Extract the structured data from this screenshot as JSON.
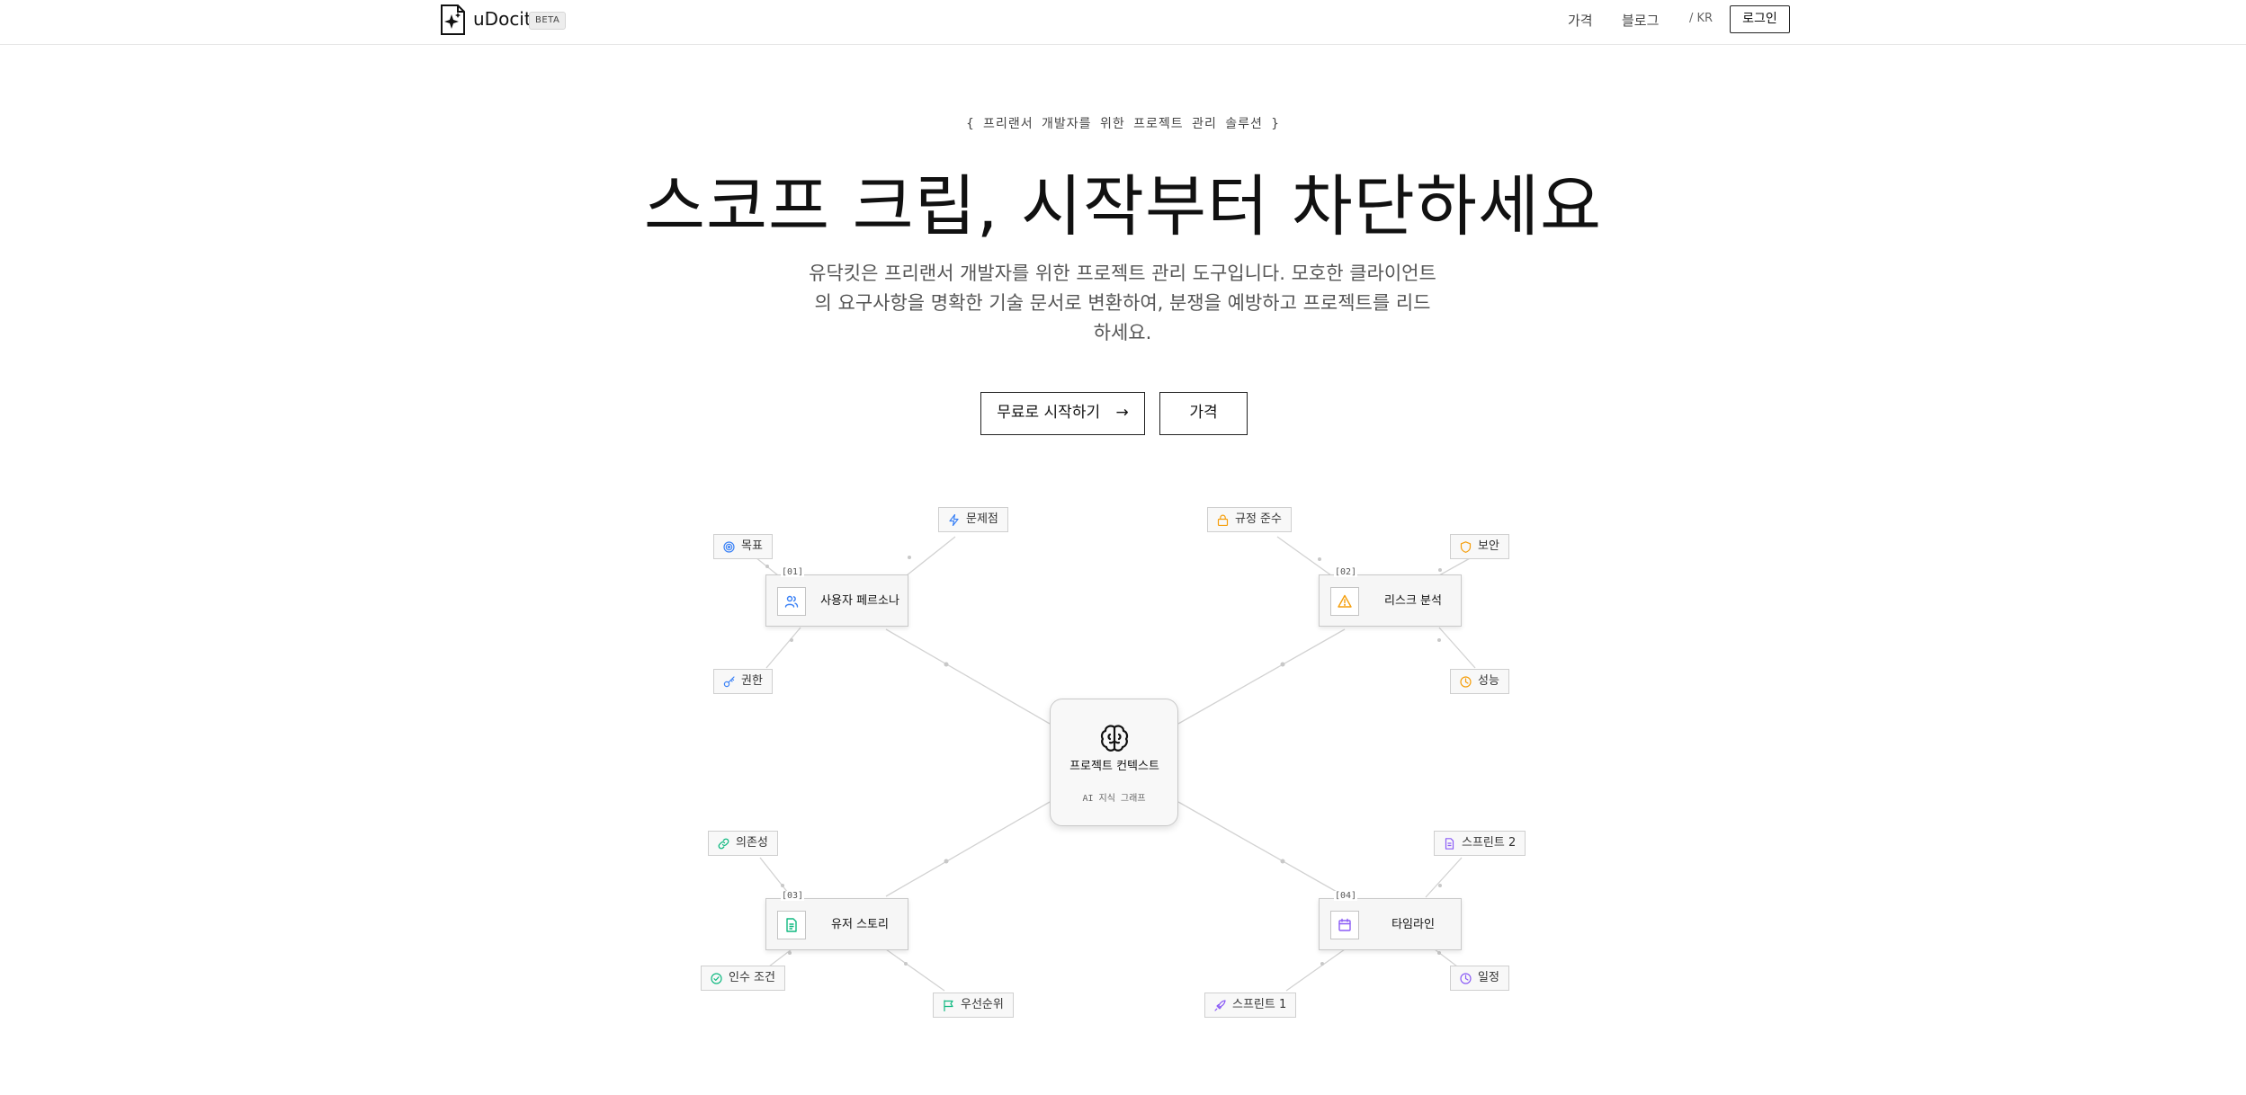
{
  "nav": {
    "logo_text": "uDocit",
    "beta_label": "BETA",
    "links": [
      "가격",
      "블로그"
    ],
    "lang": "/ KR",
    "login_label": "로그인"
  },
  "hero": {
    "tagline": "{ 프리랜서 개발자를 위한 프로젝트 관리 솔루션 }",
    "headline": "스코프 크립, 시작부터 차단하세요",
    "subtitle": "유닥킷은 프리랜서 개발자를 위한 프로젝트 관리 도구입니다. 모호한 클라이언트의 요구사항을 명확한 기술 문서로 변환하여, 분쟁을 예방하고 프로젝트를 리드하세요.",
    "cta_primary": "무료로 시작하기",
    "cta_arrow": "→",
    "cta_secondary": "가격"
  },
  "graph": {
    "center": {
      "title": "프로젝트 컨텍스트",
      "subtitle": "AI 지식 그래프",
      "icon": "brain-icon"
    },
    "nodes": [
      {
        "index": "[01]",
        "label": "사용자 페르소나",
        "icon": "users-icon",
        "color": "#3b82f6",
        "leaves": [
          {
            "label": "목표",
            "icon": "target-icon",
            "color": "#3b82f6"
          },
          {
            "label": "문제점",
            "icon": "zap-icon",
            "color": "#3b82f6"
          },
          {
            "label": "권한",
            "icon": "key-icon",
            "color": "#3b82f6"
          }
        ]
      },
      {
        "index": "[02]",
        "label": "리스크 분석",
        "icon": "alert-triangle-icon",
        "color": "#f59e0b",
        "leaves": [
          {
            "label": "규정 준수",
            "icon": "lock-icon",
            "color": "#f59e0b"
          },
          {
            "label": "보안",
            "icon": "shield-icon",
            "color": "#f59e0b"
          },
          {
            "label": "성능",
            "icon": "clock-icon",
            "color": "#f59e0b"
          }
        ]
      },
      {
        "index": "[03]",
        "label": "유저 스토리",
        "icon": "document-icon",
        "color": "#10b981",
        "leaves": [
          {
            "label": "의존성",
            "icon": "link-icon",
            "color": "#10b981"
          },
          {
            "label": "인수 조건",
            "icon": "check-circle-icon",
            "color": "#10b981"
          },
          {
            "label": "우선순위",
            "icon": "flag-icon",
            "color": "#10b981"
          }
        ]
      },
      {
        "index": "[04]",
        "label": "타임라인",
        "icon": "calendar-icon",
        "color": "#8b5cf6",
        "leaves": [
          {
            "label": "스프린트 2",
            "icon": "file-icon",
            "color": "#8b5cf6"
          },
          {
            "label": "일정",
            "icon": "clock-icon",
            "color": "#8b5cf6"
          },
          {
            "label": "스프린트 1",
            "icon": "rocket-icon",
            "color": "#8b5cf6"
          }
        ]
      }
    ]
  }
}
